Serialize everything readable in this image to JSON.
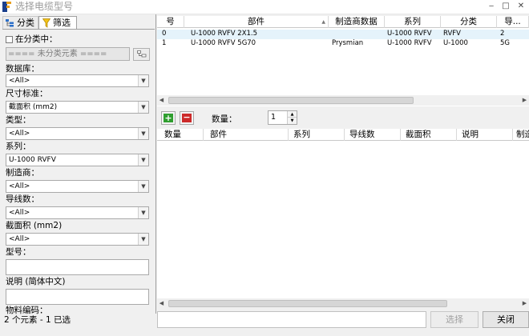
{
  "window": {
    "title": "选择电缆型号",
    "min_glyph": "‒",
    "max_glyph": "□",
    "close_glyph": "✕"
  },
  "left": {
    "tabs": [
      {
        "label": "分类"
      },
      {
        "label": "筛选"
      }
    ],
    "in_category_label": "在分类中：",
    "unclassified_text": "==== 未分类元素 ====",
    "filters": [
      {
        "label": "数据库：",
        "value": "<All>"
      },
      {
        "label": "尺寸标准：",
        "value": "截面积 (mm2)"
      },
      {
        "label": "类型：",
        "value": "<All>"
      },
      {
        "label": "系列：",
        "value": "U-1000 RVFV"
      },
      {
        "label": "制造商：",
        "value": "<All>"
      },
      {
        "label": "导线数：",
        "value": "<All>"
      },
      {
        "label": "截面积 (mm2)",
        "value": "<All>"
      }
    ],
    "model_label": "型号：",
    "desc_label": "说明 (简体中文)",
    "material_label": "物料编码：",
    "status": "2 个元素 - 1 已选"
  },
  "top_grid": {
    "columns": [
      "号",
      "部件",
      "制造商数据",
      "系列",
      "分类",
      "导..."
    ],
    "rows": [
      [
        "0",
        "U-1000 RVFV 2X1.5",
        "",
        "U-1000 RVFV",
        "RVFV",
        "2"
      ],
      [
        "1",
        "U-1000 RVFV 5G70",
        "Prysmian",
        "U-1000 RVFV",
        "U-1000",
        "5G"
      ]
    ],
    "sort_arrow": "▲"
  },
  "toolbar": {
    "add_symbol": "+",
    "remove_symbol": "−",
    "qty_label": "数量：",
    "qty_value": "1"
  },
  "bottom_grid": {
    "columns": [
      "数量",
      "部件",
      "系列",
      "导线数",
      "截面积",
      "说明",
      "制造"
    ]
  },
  "buttons": {
    "select": "选择",
    "close": "关闭"
  },
  "colors": {
    "selected_row": "#e5f3fb",
    "add_green": "#2f9e2f",
    "remove_red": "#cc2a2a"
  }
}
